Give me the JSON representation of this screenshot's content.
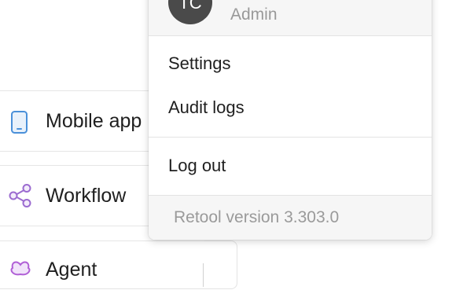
{
  "background_list": {
    "items": [
      {
        "label": "Mobile app",
        "icon": "mobile-phone-icon"
      },
      {
        "label": "Workflow",
        "icon": "share-nodes-icon"
      },
      {
        "label": "Agent",
        "icon": "agent-icon"
      }
    ]
  },
  "menu": {
    "avatar_initials": "TC",
    "user_role": "Admin",
    "items": [
      {
        "label": "Settings"
      },
      {
        "label": "Audit logs"
      },
      {
        "label": "Log out"
      }
    ],
    "version_text": "Retool version 3.303.0"
  },
  "colors": {
    "mobile_icon": "#4a90d9",
    "workflow_icon": "#9b6bd0",
    "agent_icon": "#b05fd6",
    "avatar_bg": "#4a4a4a"
  }
}
